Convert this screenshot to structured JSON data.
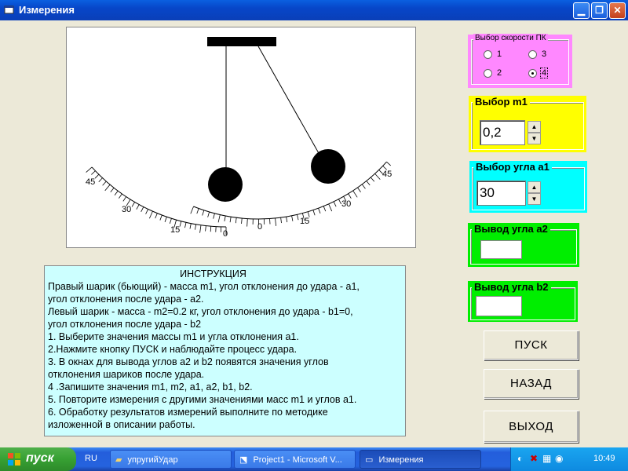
{
  "window": {
    "title": "Измерения"
  },
  "pendulum": {
    "scale_labels": [
      "45",
      "30",
      "15",
      "0",
      "0",
      "15",
      "30",
      "45"
    ]
  },
  "speed_group": {
    "legend": "Выбор скорости ПК",
    "options": [
      "1",
      "3",
      "2",
      "4"
    ],
    "selected": "4"
  },
  "m1_group": {
    "legend": "Выбор m1",
    "value": "0,2"
  },
  "a1_group": {
    "legend": "Выбор угла а1",
    "value": "30"
  },
  "a2_group": {
    "legend": "Вывод угла а2",
    "value": ""
  },
  "b2_group": {
    "legend": "Вывод угла b2",
    "value": ""
  },
  "instruction": {
    "title": "ИНСТРУКЦИЯ",
    "lines": [
      "Правый шарик (бьющий) - масса m1, угол отклонения до удара - а1,",
      "угол отклонения после удара - а2.",
      "Левый шарик  - масса  - m2=0.2 кг, угол отклонения до удара - b1=0,",
      "угол отклонения после удара - b2",
      "1. Выберите значения массы m1 и угла отклонения а1.",
      "2.Нажмите кнопку ПУСК и наблюдайте процесс удара.",
      "3. В окнах для вывода углов а2 и b2 появятся значения углов",
      "отклонения шариков после удара.",
      "4 .Запишите значения m1, m2, a1, a2, b1, b2.",
      "5. Повторите измерения с другими значениями масс m1 и углов а1.",
      "6. Обработку результатов измерений выполните по методике",
      "изложенной в описании работы."
    ]
  },
  "buttons": {
    "start": "ПУСК",
    "back": "НАЗАД",
    "exit": "ВЫХОД"
  },
  "taskbar": {
    "start_label": "пуск",
    "language": "RU",
    "tasks": [
      "упругийУдар",
      "Project1 - Microsoft V...",
      "Измерения"
    ],
    "clock": "10:49"
  },
  "colors": {
    "speed_bg": "#FF88FF",
    "m1_bg": "#FFFF00",
    "a1_bg": "#00FFFF",
    "output_bg": "#00EE00",
    "instruction_bg": "#CCFFFF"
  }
}
